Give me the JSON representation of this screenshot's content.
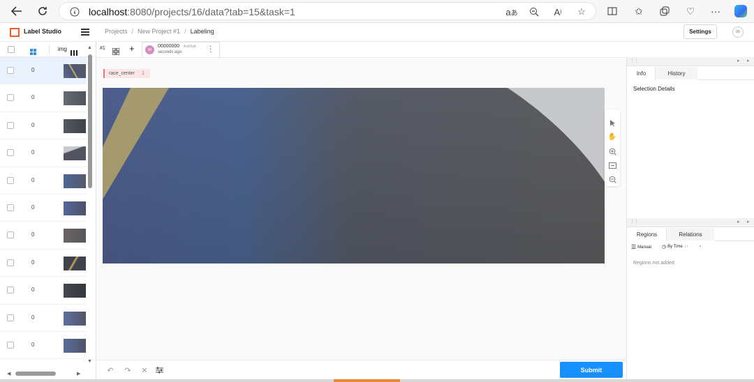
{
  "browser": {
    "url_host": "localhost",
    "url_path": ":8080/projects/16/data?tab=15&task=1"
  },
  "app": {
    "logo_text": "Label Studio",
    "breadcrumb": [
      "Projects",
      "New Project #1",
      "Labeling"
    ],
    "settings_label": "Settings",
    "avatar_initials": "00"
  },
  "sidebar": {
    "column_label": "img",
    "rows": [
      {
        "count": "0"
      },
      {
        "count": "0"
      },
      {
        "count": "0"
      },
      {
        "count": "0"
      },
      {
        "count": "0"
      },
      {
        "count": "0"
      },
      {
        "count": "0"
      },
      {
        "count": "0"
      },
      {
        "count": "0"
      },
      {
        "count": "0"
      },
      {
        "count": "0"
      }
    ]
  },
  "task": {
    "number": "#1",
    "annotation_id": "00000000",
    "annotation_user": "AsK8qK",
    "annotation_time": "seconds ago",
    "avatar": "00"
  },
  "labeling": {
    "label_name": "race_center",
    "label_hotkey": "1"
  },
  "right_panel": {
    "tab_info": "Info",
    "tab_history": "History",
    "selection_details": "Selection Details",
    "tab_regions": "Regions",
    "tab_relations": "Relations",
    "manual_label": "Manual",
    "by_time_label": "By Time",
    "regions_empty": "Regions not added"
  },
  "actions": {
    "submit_label": "Submit"
  },
  "colors": {
    "accent": "#1890ff",
    "brand": "#f05a28",
    "label": "#e07b7b"
  }
}
